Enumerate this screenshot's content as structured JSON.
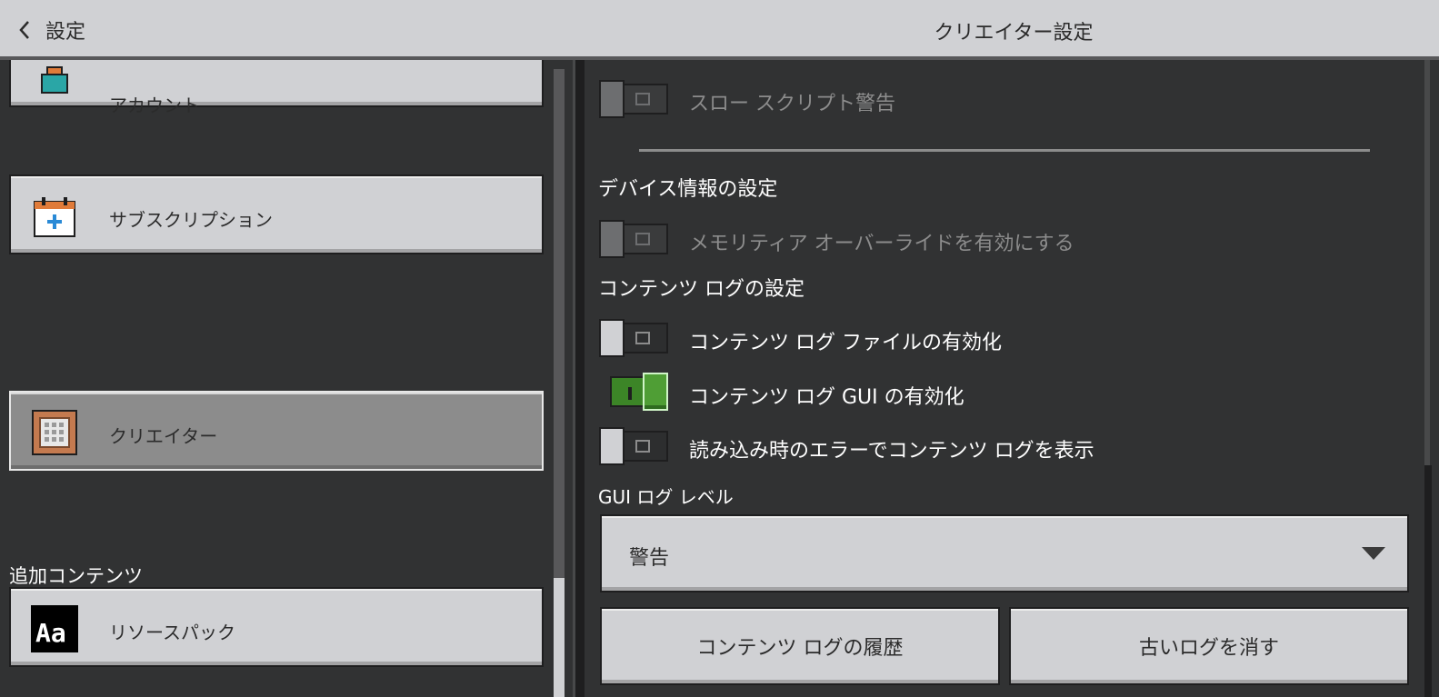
{
  "header": {
    "back_label": "設定",
    "title": "クリエイター設定"
  },
  "sidebar": {
    "items": [
      {
        "label": "アカウント",
        "icon": "account-icon"
      },
      {
        "label": "サブスクリプション",
        "icon": "subscription-calendar-icon"
      },
      {
        "label": "クリエイター",
        "icon": "command-block-icon",
        "selected": true
      }
    ],
    "section_addons": "追加コンテンツ",
    "addon_items": [
      {
        "label": "リソースパック",
        "icon": "resource-pack-icon"
      }
    ]
  },
  "main": {
    "slow_script_warning": {
      "label": "スロー スクリプト警告",
      "enabled": false,
      "disabled": true
    },
    "device_info_heading": "デバイス情報の設定",
    "memory_tier_override": {
      "label": "メモリティア オーバーライドを有効にする",
      "enabled": false,
      "disabled": true
    },
    "content_log_heading": "コンテンツ ログの設定",
    "content_log_file": {
      "label": "コンテンツ ログ ファイルの有効化",
      "enabled": false
    },
    "content_log_gui": {
      "label": "コンテンツ ログ GUI の有効化",
      "enabled": true
    },
    "show_errors_on_load": {
      "label": "読み込み時のエラーでコンテンツ ログを表示",
      "enabled": false
    },
    "gui_log_level_label": "GUI ログ レベル",
    "gui_log_level_value": "警告",
    "history_button": "コンテンツ ログの履歴",
    "clear_logs_button": "古いログを消す"
  },
  "colors": {
    "background": "#313233",
    "panel_button": "#d0d1d4",
    "toggle_on": "#3c8527",
    "divider": "#1e1e1f"
  }
}
